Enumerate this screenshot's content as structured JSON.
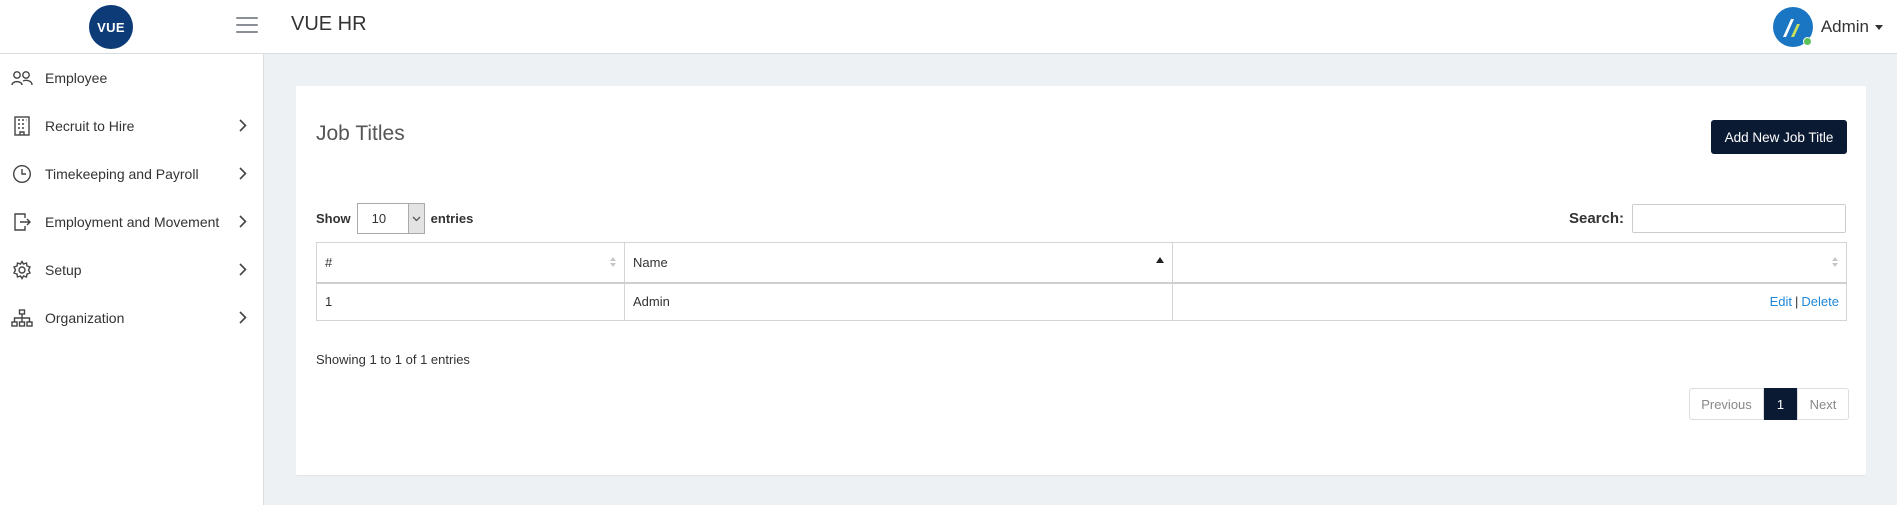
{
  "header": {
    "logo_text": "VUE",
    "app_title": "VUE HR",
    "user_name": "Admin",
    "menu_icon": "hamburger-icon",
    "avatar_icon": "user-avatar-icon"
  },
  "sidebar": {
    "items": [
      {
        "label": "Employee",
        "icon": "people-icon",
        "has_submenu": false
      },
      {
        "label": "Recruit to Hire",
        "icon": "building-icon",
        "has_submenu": true
      },
      {
        "label": "Timekeeping and Payroll",
        "icon": "clock-icon",
        "has_submenu": true
      },
      {
        "label": "Employment and Movement",
        "icon": "exit-door-icon",
        "has_submenu": true
      },
      {
        "label": "Setup",
        "icon": "gear-icon",
        "has_submenu": true
      },
      {
        "label": "Organization",
        "icon": "org-chart-icon",
        "has_submenu": true
      }
    ]
  },
  "main": {
    "title": "Job Titles",
    "add_button": "Add New Job Title",
    "show_label": "Show",
    "entries_label": "entries",
    "page_length": "10",
    "search_label": "Search:",
    "search_value": "",
    "table": {
      "columns": [
        "#",
        "Name",
        ""
      ],
      "sorted_column": "Name",
      "sort_direction": "asc",
      "rows": [
        {
          "num": "1",
          "name": "Admin",
          "edit": "Edit",
          "separator": "|",
          "delete": "Delete"
        }
      ]
    },
    "info": "Showing 1 to 1 of 1 entries",
    "pagination": {
      "previous": "Previous",
      "current": "1",
      "next": "Next"
    }
  },
  "colors": {
    "logo_bg": "#0d3b78",
    "primary_button": "#0b1a33",
    "link": "#1e88d8",
    "page_bg": "#eef1f4"
  }
}
